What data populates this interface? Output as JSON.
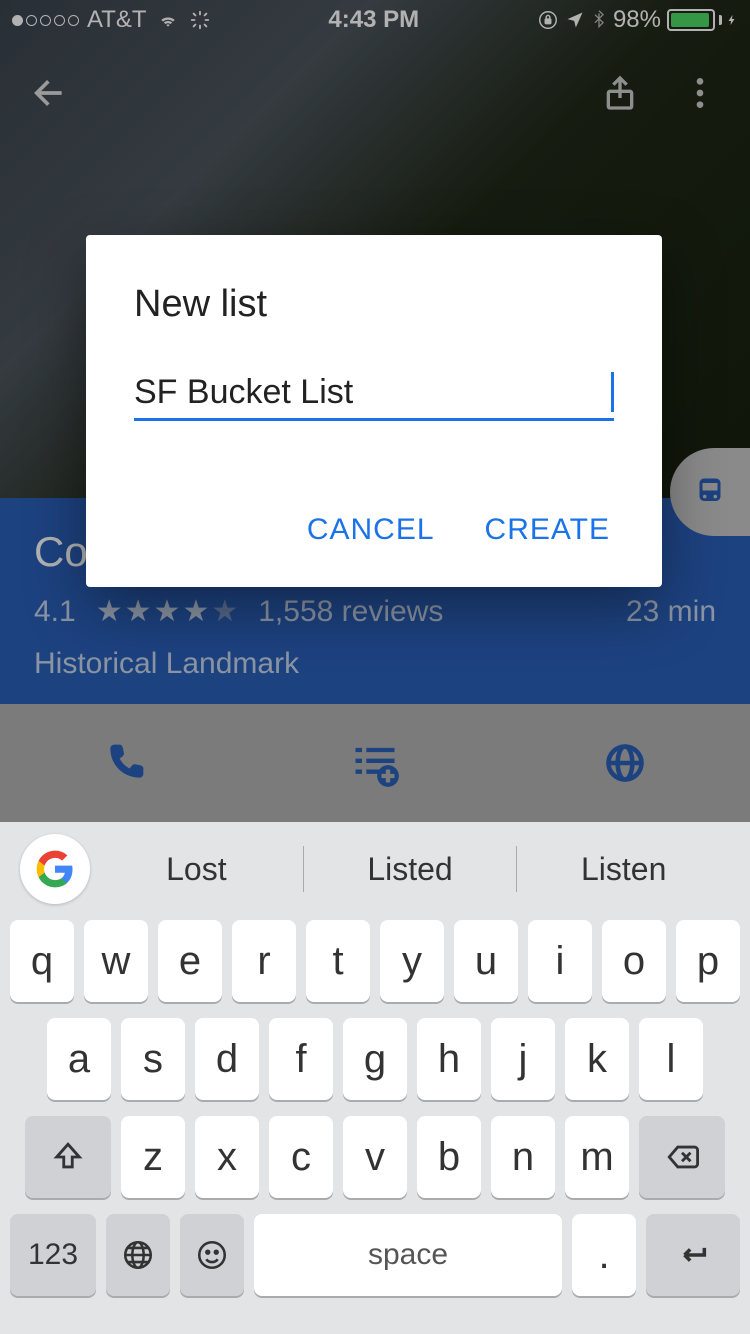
{
  "status": {
    "carrier": "AT&T",
    "time": "4:43 PM",
    "battery_pct": "98%"
  },
  "place": {
    "title_visible": "Coi",
    "rating": "4.1",
    "reviews": "1,558 reviews",
    "eta": "23 min",
    "category": "Historical Landmark"
  },
  "dialog": {
    "title": "New list",
    "input_value": "SF Bucket List",
    "cancel": "CANCEL",
    "create": "CREATE"
  },
  "suggestions": [
    "Lost",
    "Listed",
    "Listen"
  ],
  "keyboard": {
    "row1": [
      "q",
      "w",
      "e",
      "r",
      "t",
      "y",
      "u",
      "i",
      "o",
      "p"
    ],
    "row2": [
      "a",
      "s",
      "d",
      "f",
      "g",
      "h",
      "j",
      "k",
      "l"
    ],
    "row3": [
      "z",
      "x",
      "c",
      "v",
      "b",
      "n",
      "m"
    ],
    "number_key": "123",
    "space_label": "space",
    "period": "."
  }
}
